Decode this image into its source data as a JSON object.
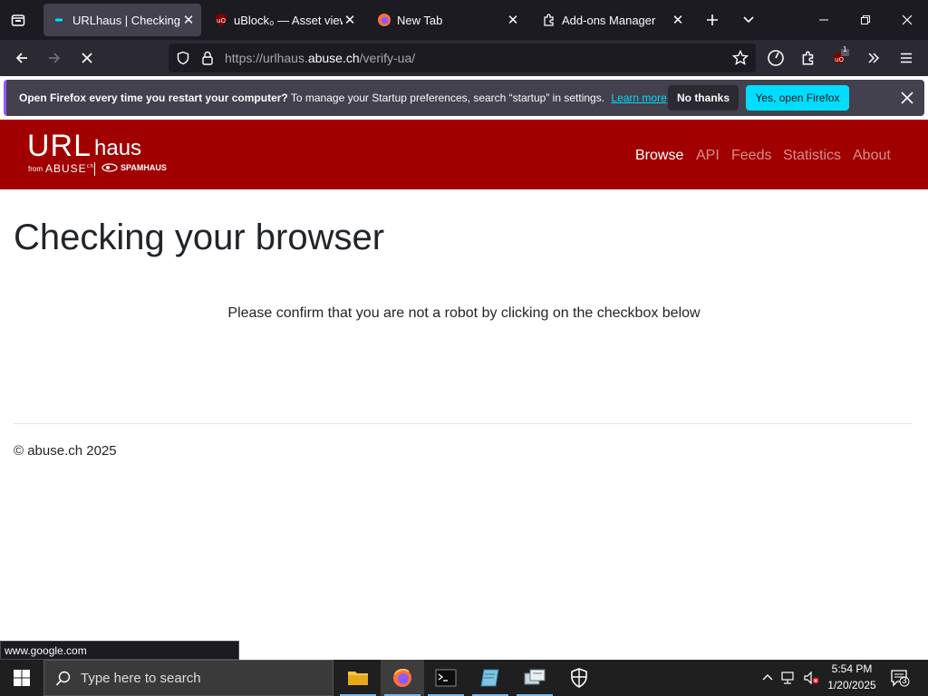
{
  "browser": {
    "tabs": [
      {
        "label": "URLhaus | Checking your browser",
        "active": true
      },
      {
        "label": "uBlock₀ — Asset viewer",
        "active": false
      },
      {
        "label": "New Tab",
        "active": false
      },
      {
        "label": "Add-ons Manager",
        "active": false
      }
    ],
    "url_prefix": "https://urlhaus.",
    "url_domain": "abuse.ch",
    "url_suffix": "/verify-ua/",
    "ublock_badge": "1"
  },
  "notification": {
    "bold_text": "Open Firefox every time you restart your computer?",
    "text": " To manage your Startup preferences, search “startup” in settings.",
    "learn_more": "Learn more",
    "no_thanks": "No thanks",
    "yes_open": "Yes, open Firefox"
  },
  "site": {
    "logo_main": "URL",
    "logo_sub": "haus",
    "logo_from": "from",
    "logo_abuse": "ABUSE",
    "logo_abuse_suffix": "ch",
    "logo_spamhaus": "SPAMHAUS",
    "nav": [
      "Browse",
      "API",
      "Feeds",
      "Statistics",
      "About"
    ],
    "title": "Checking your browser",
    "message": "Please confirm that you are not a robot by clicking on the checkbox below",
    "footer": "© abuse.ch 2025"
  },
  "status_url": "www.google.com",
  "taskbar": {
    "search_placeholder": "Type here to search",
    "time": "5:54 PM",
    "date": "1/20/2025",
    "notification_count": "3"
  },
  "colors": {
    "brand_red": "#a10000",
    "accent_cyan": "#00ddff",
    "firefox_dark": "#1c1b22"
  }
}
